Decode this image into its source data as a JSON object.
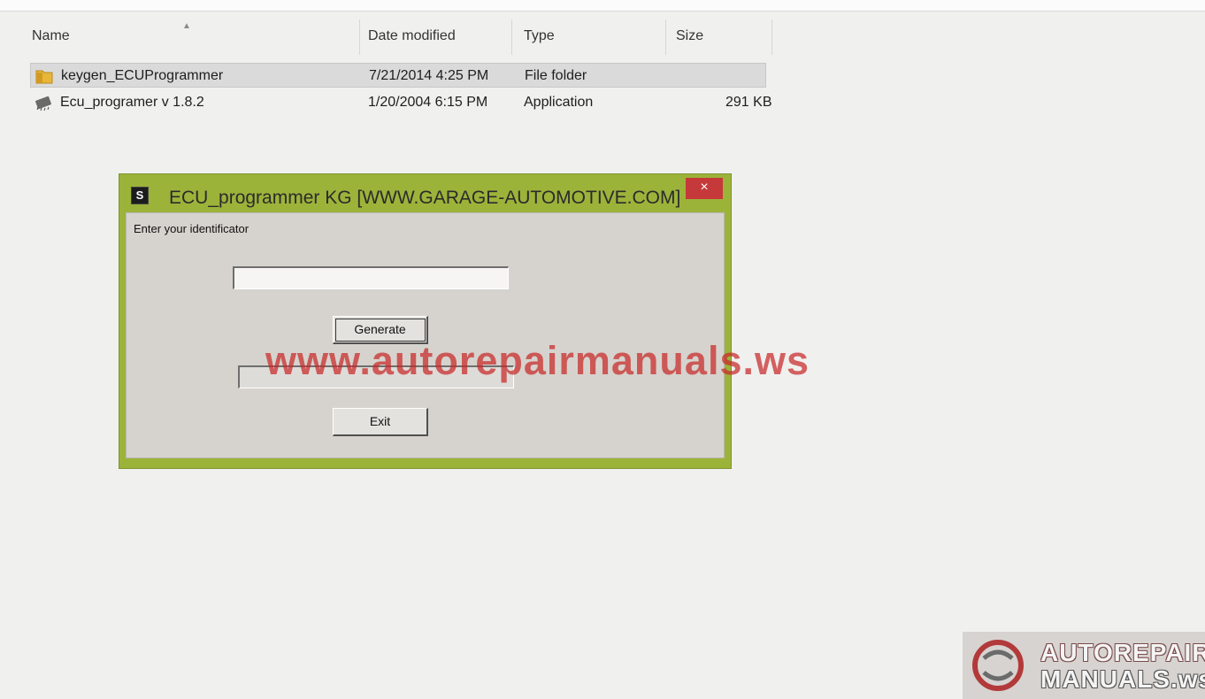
{
  "explorer": {
    "columns": {
      "name": "Name",
      "date_modified": "Date modified",
      "type": "Type",
      "size": "Size"
    },
    "rows": [
      {
        "name": "keygen_ECUProgrammer",
        "date": "7/21/2014 4:25 PM",
        "type": "File folder",
        "size": "",
        "icon": "folder-icon",
        "selected": true
      },
      {
        "name": "Ecu_programer v 1.8.2",
        "date": "1/20/2004 6:15 PM",
        "type": "Application",
        "size": "291 KB",
        "icon": "chip-application-icon",
        "selected": false
      }
    ]
  },
  "dialog": {
    "title": "ECU_programmer KG [WWW.GARAGE-AUTOMOTIVE.COM]",
    "app_icon_letter": "S",
    "close_glyph": "×",
    "prompt": "Enter your identificator",
    "identificator_value": "",
    "generated_value": "",
    "generate_label": "Generate",
    "exit_label": "Exit",
    "frame_color": "#9cb33a",
    "close_color": "#c5393a"
  },
  "watermark": {
    "text": "www.autorepairmanuals.ws",
    "color": "#c82828"
  },
  "logo": {
    "line1": "AUTOREPAIR",
    "line2": "MANUALS.ws"
  }
}
